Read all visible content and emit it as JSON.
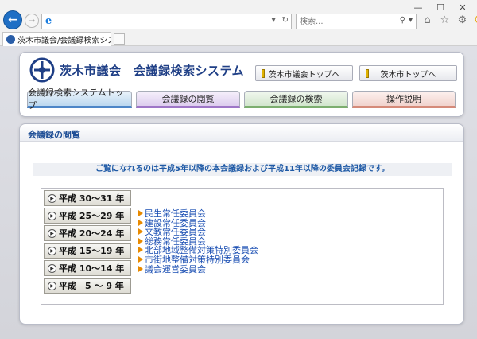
{
  "browser": {
    "window_controls": [
      "—",
      "☐",
      "✕"
    ],
    "back_icon": "back-arrow-icon",
    "forward_icon": "forward-arrow-icon",
    "address_value": "",
    "search_placeholder": "検索...",
    "tab_title": "茨木市議会/会議録検索シス...",
    "tab_close": "✕"
  },
  "header": {
    "title": "茨木市議会　会議録検索システム",
    "top_links": [
      "茨木市議会トップへ",
      "茨木市トップへ"
    ],
    "nav": [
      "会議録検索システムトップ",
      "会議録の閲覧",
      "会議録の検索",
      "操作説明"
    ]
  },
  "content": {
    "section_title": "会議録の閲覧",
    "notice": "ご覧になれるのは平成5年以降の本会議録および平成11年以降の委員会記録です。",
    "years": [
      "平成 30～31 年",
      "平成 25～29 年",
      "平成 20～24 年",
      "平成 15～19 年",
      "平成 10～14 年",
      "平成　5 ～ 9 年"
    ],
    "committees": [
      "民生常任委員会",
      "建設常任委員会",
      "文教常任委員会",
      "総務常任委員会",
      "北部地域整備対策特別委員会",
      "市街地整備対策特別委員会",
      "議会運営委員会"
    ]
  },
  "colors": {
    "accent": "#1f4f96",
    "link": "#1b4fb3",
    "arrow": "#e88a00"
  }
}
